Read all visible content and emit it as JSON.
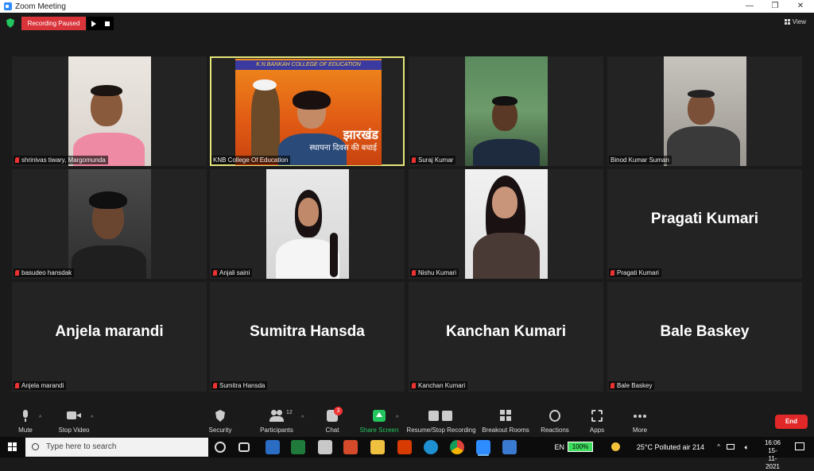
{
  "window": {
    "title": "Zoom Meeting",
    "controls": [
      "—",
      "❐",
      "✕"
    ]
  },
  "topbar": {
    "recording_status": "Recording Paused",
    "view_label": "View"
  },
  "gallery": {
    "tiles": [
      {
        "name": "shrinivas tiwary, Margomunda",
        "muted": true,
        "video": true
      },
      {
        "name": "KNB College Of Education",
        "muted": false,
        "video": true,
        "active": true,
        "banner_title": "K.N.BANKAH COLLEGE OF EDUCATION",
        "banner_hindi": "झारखंड",
        "banner_hindi2": "स्थापना दिवस की बधाई"
      },
      {
        "name": "Suraj Kumar",
        "muted": true,
        "video": true
      },
      {
        "name": "Binod Kumar Suman",
        "muted": false,
        "video": true
      },
      {
        "name": "basudeo hansdak",
        "muted": true,
        "video": true
      },
      {
        "name": "Anjali saini",
        "muted": true,
        "video": true
      },
      {
        "name": "Nishu Kumari",
        "muted": true,
        "video": true
      },
      {
        "name": "Pragati Kumari",
        "muted": true,
        "video": false,
        "display": "Pragati Kumari"
      },
      {
        "name": "Anjela marandi",
        "muted": true,
        "video": false,
        "display": "Anjela marandi"
      },
      {
        "name": "Sumitra Hansda",
        "muted": true,
        "video": false,
        "display": "Sumitra Hansda"
      },
      {
        "name": "Kanchan Kumari",
        "muted": true,
        "video": false,
        "display": "Kanchan Kumari"
      },
      {
        "name": "Bale Baskey",
        "muted": true,
        "video": false,
        "display": "Bale Baskey"
      }
    ]
  },
  "toolbar": {
    "mute": "Mute",
    "stop_video": "Stop Video",
    "security": "Security",
    "participants": "Participants",
    "participants_count": "12",
    "chat": "Chat",
    "chat_badge": "3",
    "share_screen": "Share Screen",
    "recording": "Resume/Stop Recording",
    "breakout": "Breakout Rooms",
    "reactions": "Reactions",
    "apps": "Apps",
    "more": "More",
    "end": "End",
    "caret": "^"
  },
  "taskbar": {
    "search_placeholder": "Type here to search",
    "lang": "EN",
    "battery": "100%",
    "weather": "25°C  Polluted air 214",
    "time": "16:06",
    "date": "15-11-2021"
  },
  "colors": {
    "accent": "#2D8CFF",
    "recording": "#d9343a",
    "end": "#e02828",
    "share": "#23c55e",
    "active_speaker": "#e4e77a"
  }
}
